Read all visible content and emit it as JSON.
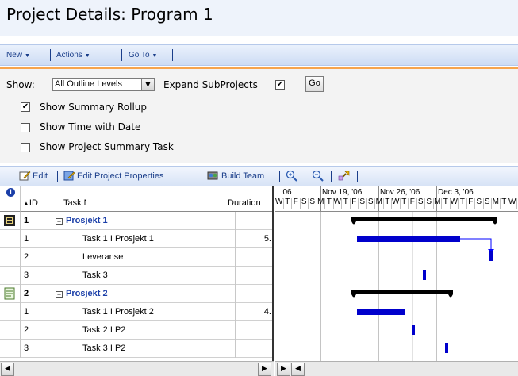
{
  "page": {
    "title": "Project Details: Program 1"
  },
  "menu": {
    "new_label": "New",
    "actions_label": "Actions",
    "goto_label": "Go To"
  },
  "options": {
    "show_label": "Show:",
    "show_value": "All Outline Levels",
    "expand_label": "Expand SubProjects",
    "expand_checked": true,
    "go_label": "Go",
    "summary_rollup_label": "Show Summary Rollup",
    "summary_rollup_checked": true,
    "time_with_date_label": "Show Time with Date",
    "time_with_date_checked": false,
    "project_summary_label": "Show Project Summary Task",
    "project_summary_checked": false
  },
  "toolbar": {
    "edit_label": "Edit",
    "edit_props_label": "Edit Project Properties",
    "build_team_label": "Build Team"
  },
  "grid": {
    "headers": {
      "info": "i",
      "id": "ID",
      "task_name": "Task Name",
      "duration": "Duration"
    },
    "rows": [
      {
        "indicator": "project",
        "id": "1",
        "name": "Prosjekt 1",
        "duration": "",
        "summary": true
      },
      {
        "indicator": "",
        "id": "1",
        "name": "Task 1 I Prosjekt 1",
        "duration": "5.",
        "summary": false
      },
      {
        "indicator": "",
        "id": "2",
        "name": "Leveranse",
        "duration": "",
        "summary": false
      },
      {
        "indicator": "",
        "id": "3",
        "name": "Task 3",
        "duration": "",
        "summary": false
      },
      {
        "indicator": "note",
        "id": "2",
        "name": "Prosjekt 2",
        "duration": "",
        "summary": true
      },
      {
        "indicator": "",
        "id": "1",
        "name": "Task 1 I Prosjekt 2",
        "duration": "4.",
        "summary": false
      },
      {
        "indicator": "",
        "id": "2",
        "name": "Task 2 I P2",
        "duration": "",
        "summary": false
      },
      {
        "indicator": "",
        "id": "3",
        "name": "Task 3 I P2",
        "duration": "",
        "summary": false
      }
    ]
  },
  "gantt": {
    "weeks": [
      ", '06",
      "Nov 19, '06",
      "Nov 26, '06",
      "Dec 3, '06"
    ],
    "days": [
      "W",
      "T",
      "F",
      "S",
      "S",
      "M",
      "T",
      "W",
      "T",
      "F",
      "S",
      "S",
      "M",
      "T",
      "W",
      "T",
      "F",
      "S",
      "S",
      "M",
      "T",
      "W",
      "T",
      "F",
      "S",
      "S",
      "M",
      "T",
      "W"
    ],
    "colors": {
      "bar": "#0000cc",
      "summary": "#000000",
      "link": "#0000ff"
    }
  }
}
